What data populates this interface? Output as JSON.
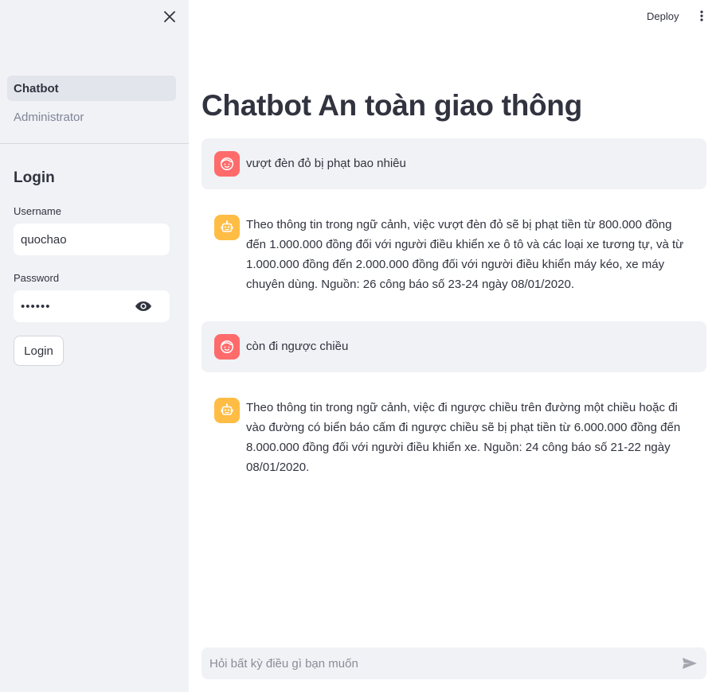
{
  "sidebar": {
    "nav": [
      {
        "label": "Chatbot",
        "active": true
      },
      {
        "label": "Administrator",
        "active": false
      }
    ],
    "close_icon": "close-icon",
    "login": {
      "title": "Login",
      "username_label": "Username",
      "username_value": "quochao",
      "password_label": "Password",
      "password_value": "••••••",
      "eye_icon": "eye-icon",
      "button_label": "Login"
    }
  },
  "header": {
    "deploy_label": "Deploy",
    "menu_icon": "kebab-menu-icon"
  },
  "main": {
    "title": "Chatbot An toàn giao thông",
    "messages": [
      {
        "role": "user",
        "avatar_icon": "user-face-icon",
        "text": "vượt đèn đỏ bị phạt bao nhiêu"
      },
      {
        "role": "assistant",
        "avatar_icon": "robot-icon",
        "text": "Theo thông tin trong ngữ cảnh, việc vượt đèn đỏ sẽ bị phạt tiền từ 800.000 đồng đến 1.000.000 đồng đối với người điều khiển xe ô tô và các loại xe tương tự, và từ 1.000.000 đồng đến 2.000.000 đồng đối với người điều khiển máy kéo, xe máy chuyên dùng. Nguồn: 26 công báo số 23-24 ngày 08/01/2020."
      },
      {
        "role": "user",
        "avatar_icon": "user-face-icon",
        "text": "còn đi ngược chiều"
      },
      {
        "role": "assistant",
        "avatar_icon": "robot-icon",
        "text": "Theo thông tin trong ngữ cảnh, việc đi ngược chiều trên đường một chiều hoặc đi vào đường có biển báo cấm đi ngược chiều sẽ bị phạt tiền từ 6.000.000 đồng đến 8.000.000 đồng đối với người điều khiển xe. Nguồn: 24 công báo số 21-22 ngày 08/01/2020."
      }
    ],
    "chat_input": {
      "placeholder": "Hỏi bất kỳ điều gì bạn muốn",
      "value": "",
      "send_icon": "send-icon"
    }
  },
  "colors": {
    "sidebar_bg": "#f0f2f6",
    "user_avatar": "#ff6b6b",
    "bot_avatar": "#ffbd45",
    "text": "#31333f"
  }
}
